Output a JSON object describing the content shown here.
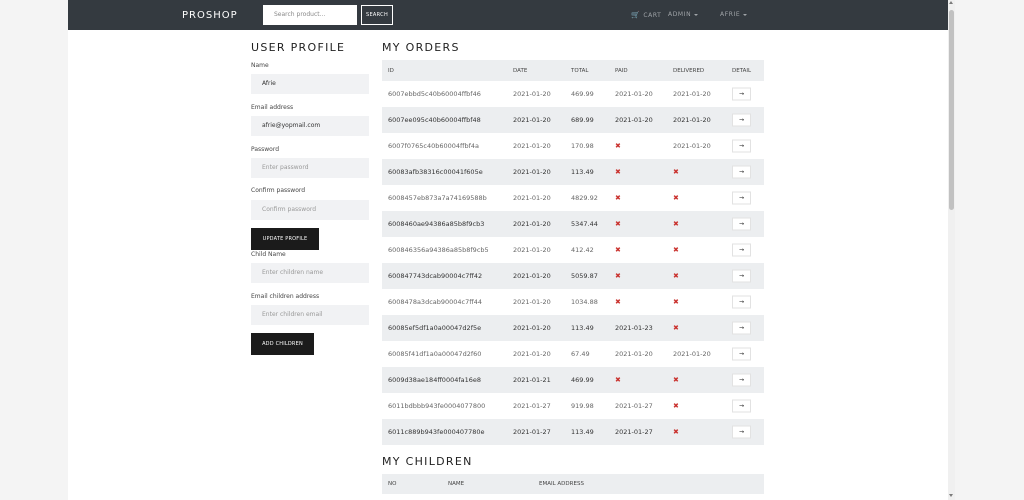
{
  "nav": {
    "brand": "PROSHOP",
    "search_placeholder": "Search product...",
    "search_button": "SEARCH",
    "cart": "CART",
    "admin": "ADMIN",
    "user": "AFRIE"
  },
  "profile": {
    "title": "USER PROFILE",
    "name_label": "Name",
    "name_value": "Afrie",
    "email_label": "Email address",
    "email_value": "afrie@yopmail.com",
    "password_label": "Password",
    "password_placeholder": "Enter password",
    "confirm_label": "Confirm password",
    "confirm_placeholder": "Confirm password",
    "update_button": "UPDATE PROFILE",
    "child_name_label": "Child Name",
    "child_name_placeholder": "Enter children name",
    "child_email_label": "Email children address",
    "child_email_placeholder": "Enter children email",
    "add_button": "ADD CHILDREN"
  },
  "orders": {
    "title": "MY ORDERS",
    "headers": [
      "ID",
      "DATE",
      "TOTAL",
      "PAID",
      "DELIVERED",
      "DETAIL"
    ],
    "rows": [
      {
        "id": "6007ebbd5c40b60004ffbf46",
        "date": "2021-01-20",
        "total": "469.99",
        "paid": "2021-01-20",
        "delivered": "2021-01-20"
      },
      {
        "id": "6007ee095c40b60004ffbf48",
        "date": "2021-01-20",
        "total": "689.99",
        "paid": "2021-01-20",
        "delivered": "2021-01-20"
      },
      {
        "id": "6007f0765c40b60004ffbf4a",
        "date": "2021-01-20",
        "total": "170.98",
        "paid": "",
        "delivered": "2021-01-20"
      },
      {
        "id": "60083afb38316c00041f605e",
        "date": "2021-01-20",
        "total": "113.49",
        "paid": "",
        "delivered": ""
      },
      {
        "id": "6008457eb873a7a74169588b",
        "date": "2021-01-20",
        "total": "4829.92",
        "paid": "",
        "delivered": ""
      },
      {
        "id": "6008460ae94386a85b8f9cb3",
        "date": "2021-01-20",
        "total": "5347.44",
        "paid": "",
        "delivered": ""
      },
      {
        "id": "600846356a94386a85b8f9cb5",
        "date": "2021-01-20",
        "total": "412.42",
        "paid": "",
        "delivered": ""
      },
      {
        "id": "600847743dcab90004c7ff42",
        "date": "2021-01-20",
        "total": "5059.87",
        "paid": "",
        "delivered": ""
      },
      {
        "id": "6008478a3dcab90004c7ff44",
        "date": "2021-01-20",
        "total": "1034.88",
        "paid": "",
        "delivered": ""
      },
      {
        "id": "60085ef5df1a0a00047d2f5e",
        "date": "2021-01-20",
        "total": "113.49",
        "paid": "2021-01-23",
        "delivered": ""
      },
      {
        "id": "60085f41df1a0a00047d2f60",
        "date": "2021-01-20",
        "total": "67.49",
        "paid": "2021-01-20",
        "delivered": "2021-01-20"
      },
      {
        "id": "6009d38ae184ff0004fa16e8",
        "date": "2021-01-21",
        "total": "469.99",
        "paid": "",
        "delivered": ""
      },
      {
        "id": "6011bdbbb943fe0004077800",
        "date": "2021-01-27",
        "total": "919.98",
        "paid": "2021-01-27",
        "delivered": ""
      },
      {
        "id": "6011c889b943fe000407780e",
        "date": "2021-01-27",
        "total": "113.49",
        "paid": "2021-01-27",
        "delivered": ""
      }
    ]
  },
  "children": {
    "title": "MY CHILDREN",
    "headers": [
      "NO",
      "NAME",
      "EMAIL ADDRESS"
    ]
  },
  "icons": {
    "cart": "shopping-cart-icon",
    "not_paid": "cross-icon",
    "detail": "arrow-right-icon"
  },
  "colors": {
    "navbar": "#343a40",
    "cross": "#c9302c",
    "row_alt": "#eceef0"
  }
}
